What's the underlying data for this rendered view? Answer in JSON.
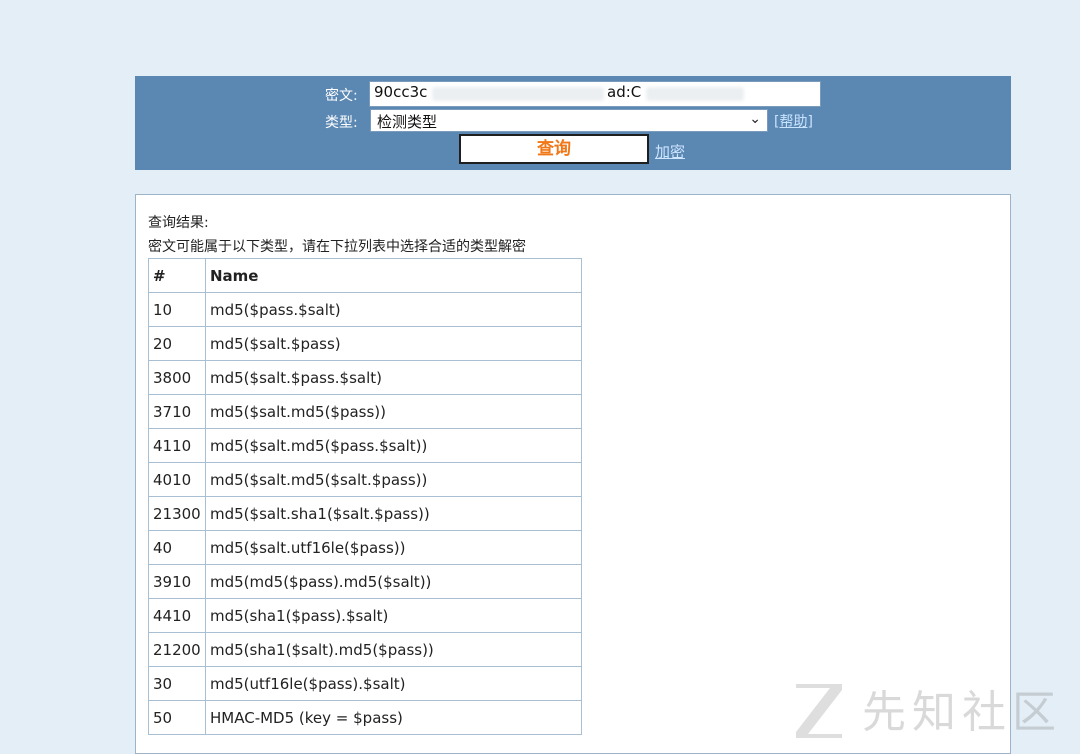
{
  "form": {
    "cipher_label": "密文:",
    "cipher_value": "90cc3c",
    "cipher_value_tail": "ad:C",
    "type_label": "类型:",
    "type_selected": "检测类型",
    "help_link": "[帮助]",
    "query_button": "查询",
    "encrypt_link": "加密"
  },
  "result": {
    "title": "查询结果:",
    "description": "密文可能属于以下类型，请在下拉列表中选择合适的类型解密",
    "columns": [
      "#",
      "Name"
    ],
    "rows": [
      {
        "id": "10",
        "name": "md5($pass.$salt)"
      },
      {
        "id": "20",
        "name": "md5($salt.$pass)"
      },
      {
        "id": "3800",
        "name": "md5($salt.$pass.$salt)"
      },
      {
        "id": "3710",
        "name": "md5($salt.md5($pass))"
      },
      {
        "id": "4110",
        "name": "md5($salt.md5($pass.$salt))"
      },
      {
        "id": "4010",
        "name": "md5($salt.md5($salt.$pass))"
      },
      {
        "id": "21300",
        "name": "md5($salt.sha1($salt.$pass))"
      },
      {
        "id": "40",
        "name": "md5($salt.utf16le($pass))"
      },
      {
        "id": "3910",
        "name": "md5(md5($pass).md5($salt))"
      },
      {
        "id": "4410",
        "name": "md5(sha1($pass).$salt)"
      },
      {
        "id": "21200",
        "name": "md5(sha1($salt).md5($pass))"
      },
      {
        "id": "30",
        "name": "md5(utf16le($pass).$salt)"
      },
      {
        "id": "50",
        "name": "HMAC-MD5 (key = $pass)"
      }
    ]
  },
  "watermark": {
    "text": "先知社区"
  },
  "colors": {
    "page_bg": "#e3eef7",
    "panel_bg": "#5b87b3",
    "query_text": "#f07818",
    "link": "#cfe6ff"
  }
}
